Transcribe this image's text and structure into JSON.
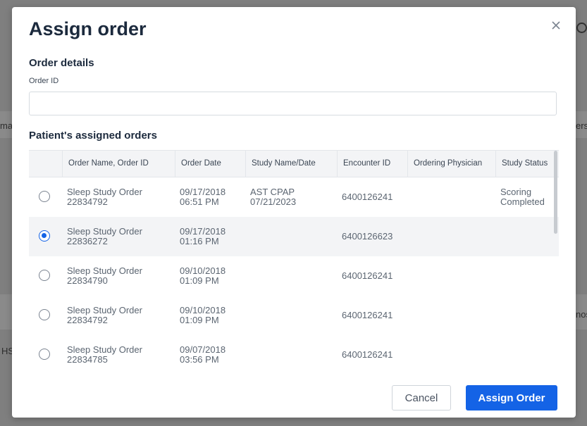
{
  "background": {
    "left_fragment_1": "ma",
    "left_fragment_2": "HS",
    "right_fragment_1": "ers",
    "right_fragment_2": "nos"
  },
  "dialog": {
    "title": "Assign order",
    "close_icon": "close-icon",
    "order_details_heading": "Order details",
    "order_id_label": "Order ID",
    "order_id_value": "",
    "assigned_orders_heading": "Patient's assigned orders",
    "columns": [
      "",
      "Order Name, Order ID",
      "Order Date",
      "Study Name/Date",
      "Encounter ID",
      "Ordering Physician",
      "Study Status"
    ],
    "rows": [
      {
        "selected": false,
        "order_name": "Sleep Study Order",
        "order_id": "22834792",
        "order_date": "09/17/2018",
        "order_time": "06:51 PM",
        "study_name": "AST CPAP",
        "study_date": "07/21/2023",
        "encounter_id": "6400126241",
        "physician": "",
        "status_1": "Scoring",
        "status_2": "Completed"
      },
      {
        "selected": true,
        "order_name": "Sleep Study Order",
        "order_id": "22836272",
        "order_date": "09/17/2018",
        "order_time": "01:16 PM",
        "study_name": "",
        "study_date": "",
        "encounter_id": "6400126623",
        "physician": "",
        "status_1": "",
        "status_2": ""
      },
      {
        "selected": false,
        "order_name": "Sleep Study Order",
        "order_id": "22834790",
        "order_date": "09/10/2018",
        "order_time": "01:09 PM",
        "study_name": "",
        "study_date": "",
        "encounter_id": "6400126241",
        "physician": "",
        "status_1": "",
        "status_2": ""
      },
      {
        "selected": false,
        "order_name": "Sleep Study Order",
        "order_id": "22834792",
        "order_date": "09/10/2018",
        "order_time": "01:09 PM",
        "study_name": "",
        "study_date": "",
        "encounter_id": "6400126241",
        "physician": "",
        "status_1": "",
        "status_2": ""
      },
      {
        "selected": false,
        "order_name": "Sleep Study Order",
        "order_id": "22834785",
        "order_date": "09/07/2018",
        "order_time": "03:56 PM",
        "study_name": "",
        "study_date": "",
        "encounter_id": "6400126241",
        "physician": "",
        "status_1": "",
        "status_2": ""
      }
    ],
    "cancel_label": "Cancel",
    "assign_label": "Assign Order"
  },
  "colors": {
    "primary": "#1463e6",
    "title_text": "#1c2a3d",
    "overlay": "#7f7f7f"
  }
}
